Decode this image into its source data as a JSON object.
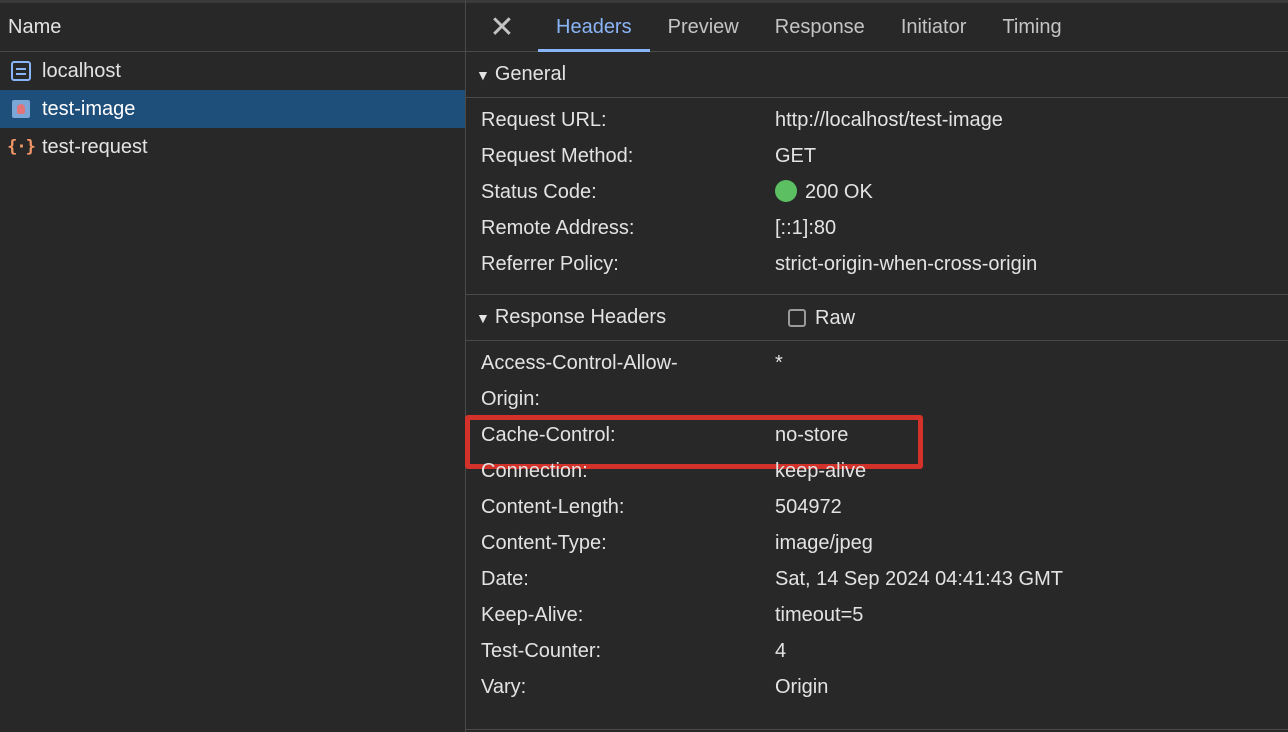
{
  "request_list": {
    "column_header": "Name",
    "items": [
      {
        "name": "localhost",
        "icon": "document-icon",
        "selected": false
      },
      {
        "name": "test-image",
        "icon": "image-icon",
        "selected": true
      },
      {
        "name": "test-request",
        "icon": "fetch-icon",
        "selected": false
      }
    ]
  },
  "detail_tabs": {
    "close_symbol": "✕",
    "tabs": [
      "Headers",
      "Preview",
      "Response",
      "Initiator",
      "Timing"
    ],
    "active": "Headers"
  },
  "general": {
    "title": "General",
    "rows": [
      {
        "key": "Request URL:",
        "value": "http://localhost/test-image"
      },
      {
        "key": "Request Method:",
        "value": "GET"
      },
      {
        "key": "Status Code:",
        "value": "200 OK"
      },
      {
        "key": "Remote Address:",
        "value": "[::1]:80"
      },
      {
        "key": "Referrer Policy:",
        "value": "strict-origin-when-cross-origin"
      }
    ]
  },
  "response_headers": {
    "title": "Response Headers",
    "raw_label": "Raw",
    "raw_checked": false,
    "rows": [
      {
        "key_line1": "Access-Control-Allow-",
        "key_line2": "Origin:",
        "value": "*"
      },
      {
        "key": "Cache-Control:",
        "value": "no-store"
      },
      {
        "key": "Connection:",
        "value": "keep-alive"
      },
      {
        "key": "Content-Length:",
        "value": "504972"
      },
      {
        "key": "Content-Type:",
        "value": "image/jpeg"
      },
      {
        "key": "Date:",
        "value": "Sat, 14 Sep 2024 04:41:43 GMT"
      },
      {
        "key": "Keep-Alive:",
        "value": "timeout=5"
      },
      {
        "key": "Test-Counter:",
        "value": "4"
      },
      {
        "key": "Vary:",
        "value": "Origin"
      }
    ]
  },
  "colors": {
    "accent": "#8ab4f8",
    "selected_row": "#1e4e7a",
    "status_ok": "#5cc063",
    "highlight_box": "#d2322a"
  }
}
